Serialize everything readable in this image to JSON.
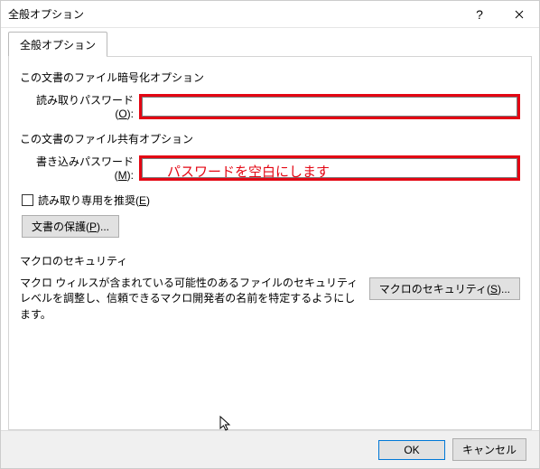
{
  "titlebar": {
    "title": "全般オプション"
  },
  "tabs": {
    "general": "全般オプション"
  },
  "section1": {
    "heading": "この文書のファイル暗号化オプション",
    "password_label_pre": "読み取りパスワード(",
    "password_label_key": "O",
    "password_label_post": "):",
    "password_value": ""
  },
  "section2": {
    "heading": "この文書のファイル共有オプション",
    "password_label_pre": "書き込みパスワード(",
    "password_label_key": "M",
    "password_label_post": "):",
    "password_value": ""
  },
  "readonly": {
    "label_pre": "読み取り専用を推奨(",
    "label_key": "E",
    "label_post": ")"
  },
  "protect_btn": {
    "label_pre": "文書の保護(",
    "label_key": "P",
    "label_post": ")..."
  },
  "macro": {
    "heading": "マクロのセキュリティ",
    "text": "マクロ ウィルスが含まれている可能性のあるファイルのセキュリティ レベルを調整し、信頼できるマクロ開発者の名前を特定するようにします。",
    "btn_pre": "マクロのセキュリティ(",
    "btn_key": "S",
    "btn_post": ")..."
  },
  "annotation": "パスワードを空白にします",
  "footer": {
    "ok": "OK",
    "cancel": "キャンセル"
  }
}
